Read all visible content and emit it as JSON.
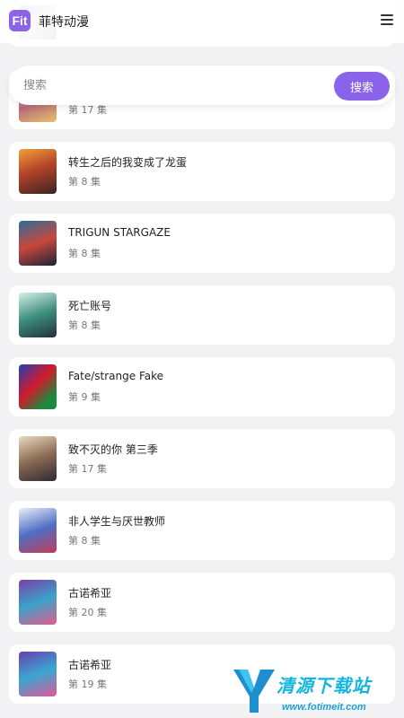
{
  "app": {
    "logo_text": "Fit",
    "title": "菲特动漫"
  },
  "search": {
    "placeholder": "搜索",
    "value": "",
    "button_label": "搜索"
  },
  "partial_card_top": {
    "episode": "第 17 集"
  },
  "cards": [
    {
      "title": "转生之后的我变成了龙蛋",
      "episode": "第 8 集"
    },
    {
      "title": "TRIGUN STARGAZE",
      "episode": "第 8 集"
    },
    {
      "title": "死亡账号",
      "episode": "第 8 集"
    },
    {
      "title": "Fate/strange Fake",
      "episode": "第 9 集"
    },
    {
      "title": "致不灭的你 第三季",
      "episode": "第 17 集"
    },
    {
      "title": "非人学生与厌世教师",
      "episode": "第 8 集"
    },
    {
      "title": "古诺希亚",
      "episode": "第 20 集"
    },
    {
      "title": "古诺希亚",
      "episode": "第 19 集"
    }
  ],
  "watermark": {
    "text": "清源下载站",
    "url": "www.fotimeit.com"
  },
  "colors": {
    "accent": "#8a63e8",
    "background": "#f2f2f4",
    "card": "#ffffff"
  },
  "icons": {
    "menu": "hamburger-menu-icon"
  }
}
